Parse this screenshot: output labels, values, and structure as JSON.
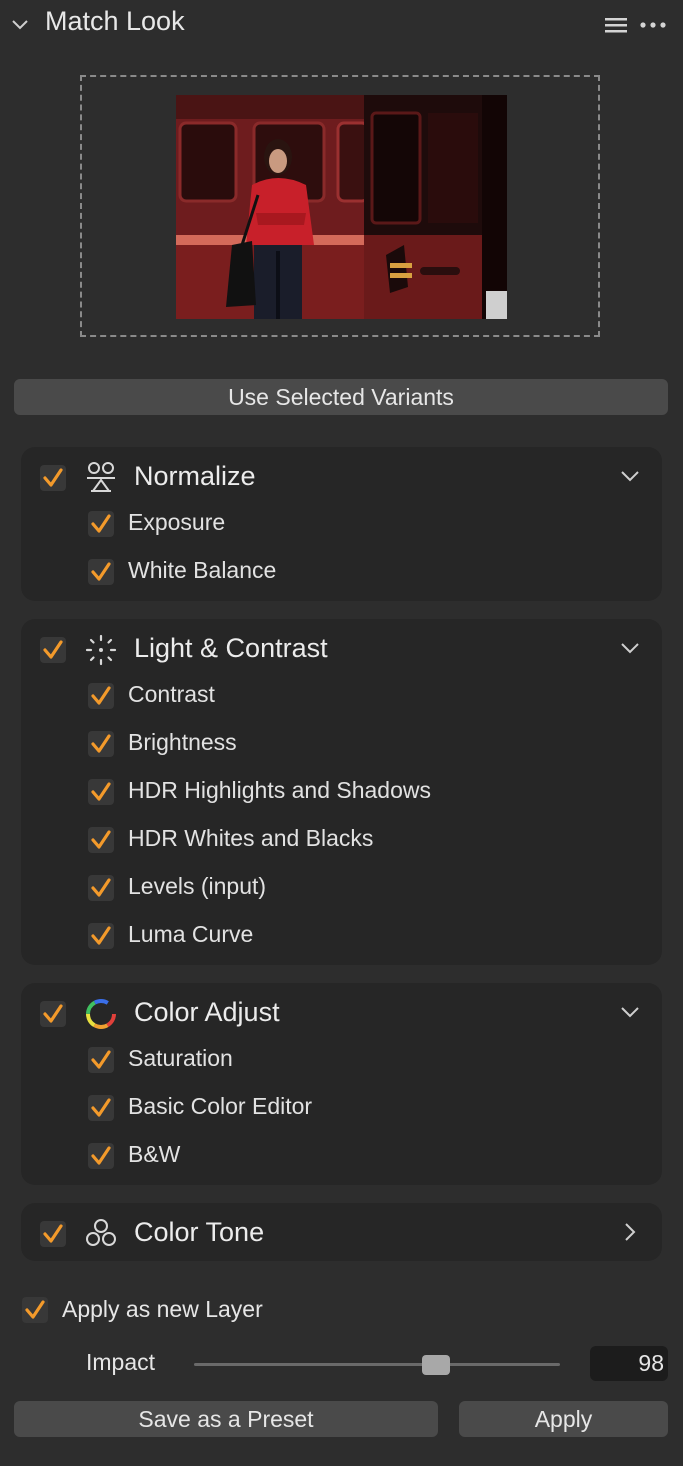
{
  "panel": {
    "title": "Match Look",
    "chevron_icon": "chevron-down-icon",
    "menu_icon": "hamburger-menu-icon",
    "more_icon": "more-dots-icon"
  },
  "reference_image": {
    "alt": "Reference photo: woman in red jacket by red train"
  },
  "use_selected_variants_label": "Use Selected Variants",
  "colors": {
    "accent_check": "#f39a2b",
    "panel_bg": "#2d2d2d",
    "group_bg": "#262626",
    "button_bg": "#4a4a4a"
  },
  "groups": [
    {
      "title": "Normalize",
      "icon": "normalize-icon",
      "checked": true,
      "expanded": true,
      "items": [
        {
          "label": "Exposure",
          "checked": true
        },
        {
          "label": "White Balance",
          "checked": true
        }
      ]
    },
    {
      "title": "Light & Contrast",
      "icon": "light-contrast-icon",
      "checked": true,
      "expanded": true,
      "items": [
        {
          "label": "Contrast",
          "checked": true
        },
        {
          "label": "Brightness",
          "checked": true
        },
        {
          "label": "HDR Highlights and Shadows",
          "checked": true
        },
        {
          "label": "HDR Whites and Blacks",
          "checked": true
        },
        {
          "label": "Levels (input)",
          "checked": true
        },
        {
          "label": "Luma Curve",
          "checked": true
        }
      ]
    },
    {
      "title": "Color Adjust",
      "icon": "color-wheel-icon",
      "checked": true,
      "expanded": true,
      "items": [
        {
          "label": "Saturation",
          "checked": true
        },
        {
          "label": "Basic Color Editor",
          "checked": true
        },
        {
          "label": "B&W",
          "checked": true
        }
      ]
    },
    {
      "title": "Color Tone",
      "icon": "color-tone-icon",
      "checked": true,
      "expanded": false,
      "items": []
    }
  ],
  "apply_as_new_layer": {
    "label": "Apply as new Layer",
    "checked": true
  },
  "impact": {
    "label": "Impact",
    "value": "98",
    "fraction": 0.66
  },
  "save_preset_label": "Save as a Preset",
  "apply_label": "Apply"
}
